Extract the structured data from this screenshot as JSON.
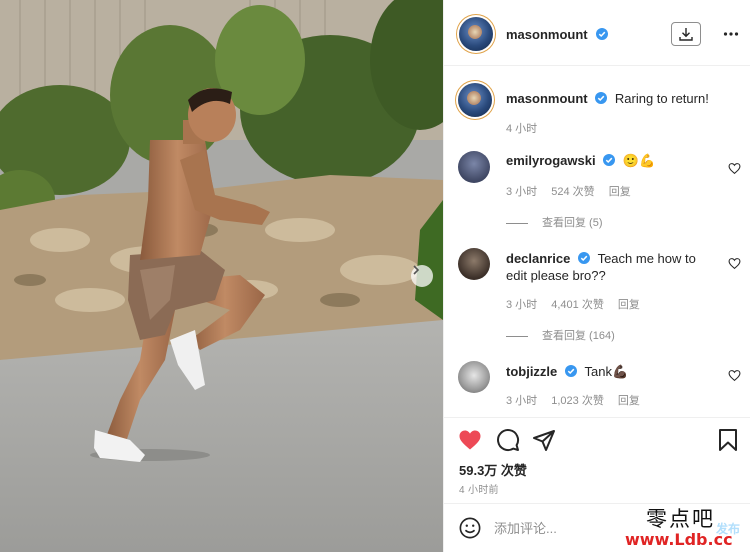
{
  "post": {
    "author": "masonmount",
    "caption": "Raring to return!",
    "caption_time": "4 小时",
    "likes": "59.3万 次赞",
    "time": "4 小时前"
  },
  "comments": [
    {
      "user": "emilyrogawski",
      "text": "🙂💪",
      "time": "3 小时",
      "likes": "524 次赞",
      "reply": "回复",
      "view_replies": "查看回复 (5)"
    },
    {
      "user": "declanrice",
      "text": "Teach me how to edit please bro??",
      "time": "3 小时",
      "likes": "4,401 次赞",
      "reply": "回复",
      "view_replies": "查看回复 (164)"
    },
    {
      "user": "tobjizzle",
      "text": "Tank💪🏿",
      "time": "3 小时",
      "likes": "1,023 次赞",
      "reply": "回复"
    }
  ],
  "comment_box": {
    "placeholder": "添加评论...",
    "post_label": "发布"
  },
  "watermark": {
    "top": "零点吧",
    "bottom": "www.Ldb.cc"
  },
  "icons": {
    "verified": "verified-badge-icon",
    "download": "download-icon",
    "more": "more-options-icon",
    "like": "heart-icon",
    "comment": "comment-bubble-icon",
    "share": "paper-plane-icon",
    "save": "bookmark-icon",
    "emoji": "emoji-icon",
    "carousel": "chevron-right-icon"
  },
  "colors": {
    "like_red": "#ed4956",
    "verified_blue": "#3897f0",
    "link_blue": "#b2dffc",
    "muted": "#8e8e8e"
  }
}
